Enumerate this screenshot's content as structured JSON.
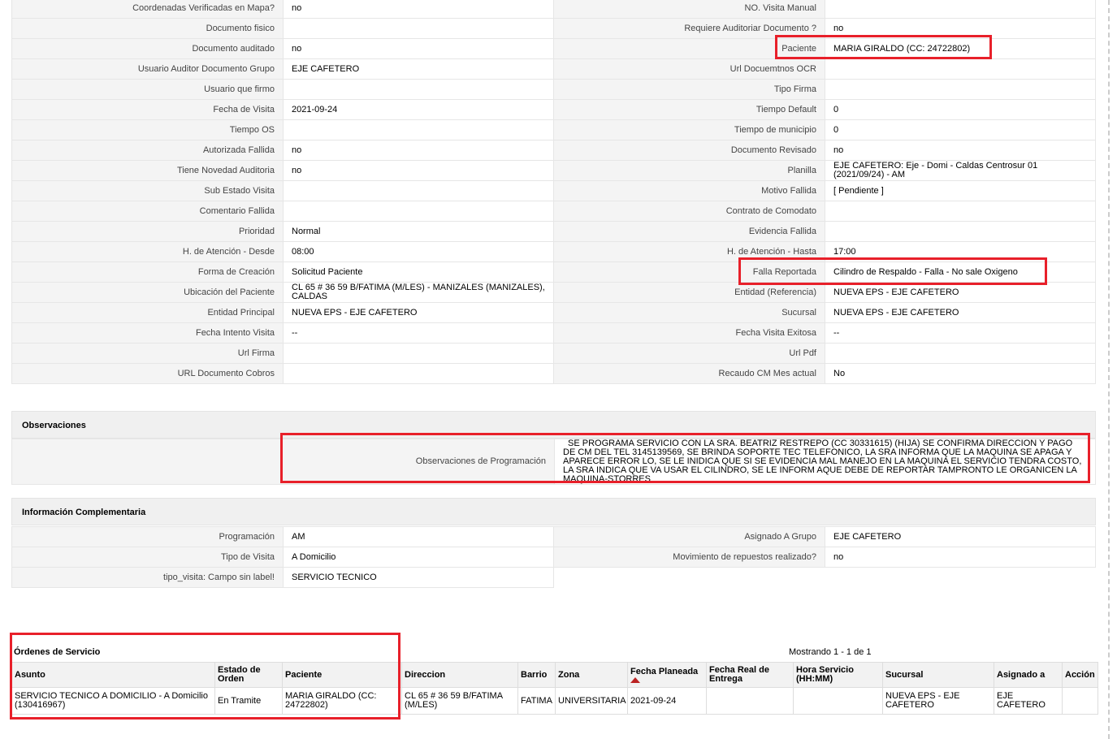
{
  "detail_rows": [
    {
      "l1": "Coordenadas Verificadas en Mapa?",
      "v1": "no",
      "l2": "NO. Visita Manual",
      "v2": ""
    },
    {
      "l1": "Documento fisico",
      "v1": "",
      "l2": "Requiere Auditoriar Documento ?",
      "v2": "no"
    },
    {
      "l1": "Documento auditado",
      "v1": "no",
      "l2": "Paciente",
      "v2": "MARIA GIRALDO (CC: 24722802)"
    },
    {
      "l1": "Usuario Auditor Documento Grupo",
      "v1": "EJE CAFETERO",
      "l2": "Url Docuemtnos OCR",
      "v2": ""
    },
    {
      "l1": "Usuario que firmo",
      "v1": "",
      "l2": "Tipo Firma",
      "v2": ""
    },
    {
      "l1": "Fecha de Visita",
      "v1": "2021-09-24",
      "l2": "Tiempo Default",
      "v2": "0"
    },
    {
      "l1": "Tiempo OS",
      "v1": "",
      "l2": "Tiempo de municipio",
      "v2": "0"
    },
    {
      "l1": "Autorizada Fallida",
      "v1": "no",
      "l2": "Documento Revisado",
      "v2": "no"
    },
    {
      "l1": "Tiene Novedad Auditoria",
      "v1": "no",
      "l2": "Planilla",
      "v2": "EJE CAFETERO: Eje - Domi - Caldas Centrosur 01 (2021/09/24) - AM"
    },
    {
      "l1": "Sub Estado Visita",
      "v1": "",
      "l2": "Motivo Fallida",
      "v2": "[ Pendiente ]"
    },
    {
      "l1": "Comentario Fallida",
      "v1": "",
      "l2": "Contrato de Comodato",
      "v2": ""
    },
    {
      "l1": "Prioridad",
      "v1": "Normal",
      "l2": "Evidencia Fallida",
      "v2": ""
    },
    {
      "l1": "H. de Atención - Desde",
      "v1": "08:00",
      "l2": "H. de Atención - Hasta",
      "v2": "17:00"
    },
    {
      "l1": "Forma de Creación",
      "v1": "Solicitud Paciente",
      "l2": "Falla Reportada",
      "v2": "Cilindro de Respaldo - Falla - No sale Oxigeno"
    },
    {
      "l1": "Ubicación del Paciente",
      "v1": "CL 65 # 36 59 B/FATIMA (M/LES) - MANIZALES (MANIZALES), CALDAS",
      "l2": "Entidad (Referencia)",
      "v2": "NUEVA EPS - EJE CAFETERO"
    },
    {
      "l1": "Entidad Principal",
      "v1": "NUEVA EPS - EJE CAFETERO",
      "l2": "Sucursal",
      "v2": "NUEVA EPS - EJE CAFETERO"
    },
    {
      "l1": "Fecha Intento Visita",
      "v1": "--",
      "l2": "Fecha Visita Exitosa",
      "v2": "--"
    },
    {
      "l1": "Url Firma",
      "v1": "",
      "l2": "Url Pdf",
      "v2": ""
    },
    {
      "l1": "URL Documento Cobros",
      "v1": "",
      "l2": "Recaudo CM Mes actual",
      "v2": "No"
    }
  ],
  "observaciones": {
    "title": "Observaciones",
    "label": "Observaciones de Programación",
    "value": "SE PROGRAMA SERVICIO CON LA SRA. BEATRIZ RESTREPO (CC 30331615) (HIJA) SE CONFIRMA DIRECCION Y PAGO DE CM DEL TEL 3145139569, SE BRINDA SOPORTE TEC TELEFONICO, LA SRA INFORMA QUE LA MAQUINA SE APAGA Y APARECE ERROR LO, SE LE INIDICA QUE SI SE EVIDENCIA MAL MANEJO EN LA MAQUINA EL SERVICIO TENDRA COSTO, LA SRA INDICA QUE VA USAR EL CILINDRO, SE LE INFORM AQUE DEBE DE REPORTAR TAMPRONTO LE ORGANICEN LA MAQUINA-STORRES"
  },
  "complementaria": {
    "title": "Información Complementaria",
    "rows": [
      {
        "l1": "Programación",
        "v1": "AM",
        "l2": "Asignado A Grupo",
        "v2": "EJE CAFETERO"
      },
      {
        "l1": "Tipo de Visita",
        "v1": "A Domicilio",
        "l2": "Movimiento de repuestos realizado?",
        "v2": "no"
      },
      {
        "l1": "tipo_visita: Campo sin label!",
        "v1": "SERVICIO TECNICO"
      }
    ]
  },
  "orders": {
    "title": "Órdenes de Servicio",
    "count_text": "Mostrando 1 - 1 de 1",
    "headers": [
      "Asunto",
      "Estado de Orden",
      "Paciente",
      "Direccion",
      "Barrio",
      "Zona",
      "Fecha Planeada",
      "Fecha Real de Entrega",
      "Hora Servicio (HH:MM)",
      "Sucursal",
      "Asignado a",
      "Acción"
    ],
    "rows": [
      [
        "SERVICIO TECNICO A DOMICILIO - A Domicilio (130416967)",
        "En Tramite",
        "MARIA GIRALDO (CC: 24722802)",
        "CL 65 # 36 59 B/FATIMA (M/LES)",
        "FATIMA",
        "UNIVERSITARIA",
        "2021-09-24",
        "",
        "",
        "NUEVA EPS - EJE CAFETERO",
        "EJE CAFETERO",
        ""
      ]
    ]
  },
  "colors": {
    "highlight_border": "#e8202a",
    "label_bg": "#f4f4f4",
    "sort_arrow": "#b22222"
  }
}
